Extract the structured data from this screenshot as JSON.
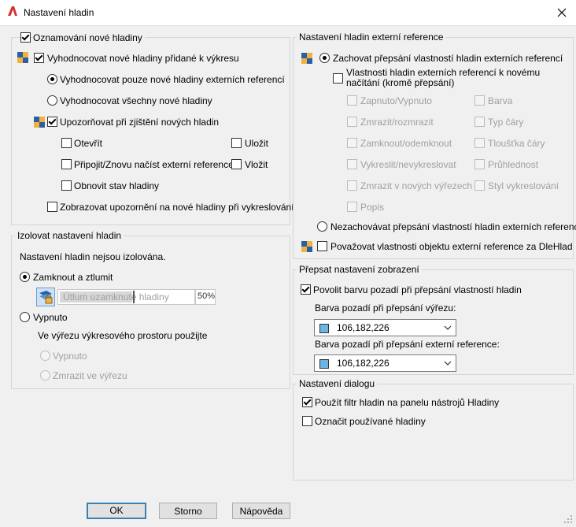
{
  "window": {
    "title": "Nastavení hladin",
    "accent": "#3c7fb1",
    "app_icon_color": "#d32f2f"
  },
  "new_layers": {
    "group_label": "Oznamování nové hladiny",
    "evaluate_label": "Vyhodnocovat nové hladiny přidané k výkresu",
    "radio_xref_only": "Vyhodnocovat pouze nové hladiny externích referencí",
    "radio_all": "Vyhodnocovat všechny nové hladiny",
    "notify_label": "Upozorňovat při zjištění nových hladin",
    "open": "Otevřít",
    "save": "Uložit",
    "attach_reload": "Připojit/Znovu načíst externí reference",
    "insert": "Vložit",
    "restore_state": "Obnovit stav hladiny",
    "warn_plot": "Zobrazovat upozornění na nové hladiny při vykreslování"
  },
  "isolate": {
    "group_label": "Izolovat nastavení hladin",
    "status": "Nastavení hladin nejsou izolována.",
    "lock_fade": "Zamknout a ztlumit",
    "fade_placeholder": "Útlum uzamknuté hladiny",
    "fade_value": "50%",
    "off": "Vypnuto",
    "viewport_note": "Ve výřezu výkresového prostoru použijte",
    "vp_off": "Vypnuto",
    "vp_freeze": "Zmrazit ve výřezu"
  },
  "xref": {
    "group_label": "Nastavení hladin externí reference",
    "retain": "Zachovat přepsání vlastností hladin externích referencí",
    "reload_line1": "Vlastnosti hladin externích referencí k novému",
    "reload_line2": "načítání (kromě přepsání)",
    "props_left": [
      "Zapnuto/Vypnuto",
      "Zmrazit/rozmrazit",
      "Zamknout/odemknout",
      "Vykreslit/nevykreslovat",
      "Zmrazit v nových výřezech",
      "Popis"
    ],
    "props_right": [
      "Barva",
      "Typ čáry",
      "Tloušťka čáry",
      "Průhlednost",
      "Styl vykreslování"
    ],
    "dont_retain": "Nezachovávat přepsání vlastností hladin externích referencí",
    "treat_dlehlad": "Považovat vlastnosti objektu externí reference za DleHlad"
  },
  "display": {
    "group_label": "Přepsat nastavení zobrazení",
    "enable_bg": "Povolit barvu pozadí při přepsání vlastností hladin",
    "vp_bg_label": "Barva pozadí při přepsání výřezu:",
    "vp_bg_value": "106,182,226",
    "xref_bg_label": "Barva pozadí při přepsání externí reference:",
    "xref_bg_value": "106,182,226",
    "swatch_color": "#6ab6e2"
  },
  "dialog": {
    "group_label": "Nastavení dialogu",
    "filter": "Použít filtr hladin na panelu nástrojů Hladiny",
    "mark_used": "Označit používané hladiny"
  },
  "buttons": {
    "ok": "OK",
    "cancel": "Storno",
    "help": "Nápověda"
  }
}
